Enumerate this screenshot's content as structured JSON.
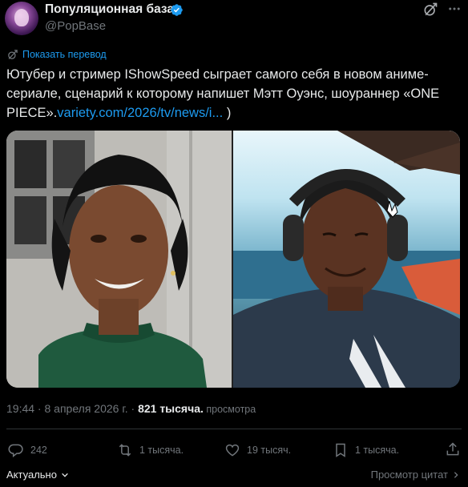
{
  "author": {
    "name": "Популяционная база",
    "handle": "@PopBase"
  },
  "translate": {
    "label": "Показать перевод"
  },
  "tweet": {
    "text_part1": "Ютубер и стример IShowSpeed сыграет самого себя в новом аниме-сериале, сценарий к которому напишет Мэтт Оуэнс, шоураннер «ONE PIECE».",
    "link": "variety.com/2026/tv/news/i...",
    "text_part2": " )"
  },
  "meta": {
    "time": "19:44",
    "sep1": " · ",
    "date": "8 апреля 2026 г.",
    "sep2": " · ",
    "views_count": "821 тысяча.",
    "views_label": " просмотра"
  },
  "actions": {
    "replies": "242",
    "reposts": "1 тысяча.",
    "likes": "19 тысяч.",
    "bookmarks": "1 тысяча."
  },
  "bottom": {
    "sort_label": "Актуально",
    "quotes_label": "Просмотр цитат"
  },
  "colors": {
    "accent": "#1d9bf0",
    "muted": "#71767b",
    "text": "#e7e9ea",
    "background": "#000000"
  }
}
